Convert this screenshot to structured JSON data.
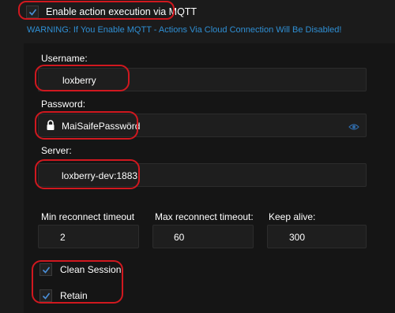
{
  "mqtt_toggle": {
    "label": "Enable action execution via MQTT",
    "checked": true
  },
  "warning": "WARNING: If You Enable MQTT - Actions Via Cloud Connection Will Be Disabled!",
  "username": {
    "label": "Username:",
    "value": "loxberry"
  },
  "password": {
    "label": "Password:",
    "value": "MaiSaifePasswörd",
    "lock_icon": "lock-icon",
    "reveal_icon": "eye-icon"
  },
  "server": {
    "label": "Server:",
    "value": "loxberry-dev:1883"
  },
  "timeouts": {
    "min_reconnect": {
      "label": "Min reconnect timeout",
      "value": "2"
    },
    "max_reconnect": {
      "label": "Max reconnect timeout:",
      "value": "60"
    },
    "keep_alive": {
      "label": "Keep alive:",
      "value": "300"
    }
  },
  "clean_session": {
    "label": "Clean Session",
    "checked": true
  },
  "retain": {
    "label": "Retain",
    "checked": true
  },
  "colors": {
    "background": "#1b1b1b",
    "warning_text": "#2f8fd4",
    "highlight_ring": "#d0181f",
    "checkmark": "#4a8fd8"
  }
}
